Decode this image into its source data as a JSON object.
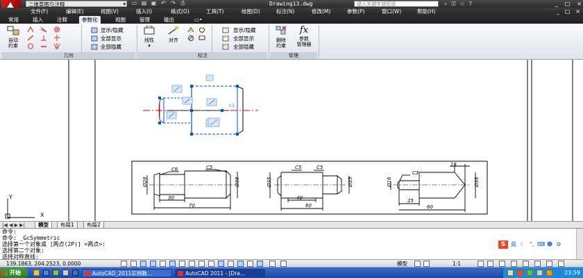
{
  "titlebar": {
    "workspace": "二维草图与注释",
    "document_title": "Drawing13.dwg",
    "search_placeholder": "键入关键字或短语",
    "icons": [
      "binoculars-icon",
      "lock-icon",
      "star-icon",
      "help-icon"
    ],
    "window_buttons": [
      "_",
      "□",
      "×"
    ]
  },
  "menu": {
    "items": [
      "文件(F)",
      "编辑(E)",
      "视图(V)",
      "插入(I)",
      "格式(O)",
      "工具(T)",
      "绘图(D)",
      "标注(N)",
      "修改(M)",
      "参数(P)",
      "窗口(W)",
      "帮助(H)"
    ],
    "right": [
      "_",
      "□",
      "×"
    ]
  },
  "ribbon_tabs": {
    "items": [
      "常用",
      "插入",
      "注释",
      "参数化",
      "视图",
      "管理",
      "输出"
    ],
    "active_index": 3
  },
  "ribbon": {
    "geometry": {
      "title": "几何",
      "auto_constrain": "自动\n约束",
      "show_hide": "显示/隐藏",
      "show_all": "全部显示",
      "hide_all": "全部隐藏"
    },
    "dimensional": {
      "title": "标注",
      "linear": "线性",
      "aligned": "对齐",
      "show_hide": "显示/隐藏",
      "show_all": "全部显示",
      "hide_all": "全部隐藏"
    },
    "manage": {
      "title": "管理",
      "delete_constraints": "删除\n约束",
      "parameters_manager": "参数\n管理器",
      "fx_symbol": "fx"
    }
  },
  "drawing": {
    "ucs_y": "Y",
    "ucs_x": "X",
    "dim_labels": {
      "c6": "C6",
      "c5a": "C5",
      "d28a": "Ø28",
      "d38a": "Ø38",
      "l30": "30",
      "l70": "70",
      "c5b": "C5",
      "c5c": "C5",
      "d35a": "Ø35",
      "d35b": "Ø35",
      "l40": "40",
      "l60a": "60",
      "c3": "C3",
      "l15": "15",
      "d16": "Ø16",
      "d38b": "Ø38",
      "l25": "25",
      "l60b": "60"
    }
  },
  "layout_tabs": {
    "nav": "|◀ ◀ ▶ ▶|",
    "items": [
      "模型",
      "布局1",
      "布局2"
    ],
    "active_index": 0
  },
  "command": {
    "lines": [
      "命令:",
      "命令: _GcSymmetric",
      "选择第一个对象或 [两点(2P)] <两点>:",
      "选择第二个对象:",
      "选择对称直线:"
    ],
    "ime_label": "英"
  },
  "status": {
    "coords": "139.1863, 204.2523, 0.0000",
    "model": "模型",
    "scale": "1:1"
  },
  "taskbar": {
    "start": "开始",
    "tasks": [
      "AutoCAD_2011实例教...",
      "AutoCAD 2011 - [Dra..."
    ],
    "active_task": 1,
    "clock": "23:59"
  },
  "colors": {
    "titlebar": "#2b2b2b",
    "ribbon_active_tab": "#e9eef5",
    "constraint_blue": "#0050d0",
    "centerline_red": "#e00000",
    "taskbar_blue": "#245edb",
    "start_green": "#3a8a2e"
  }
}
